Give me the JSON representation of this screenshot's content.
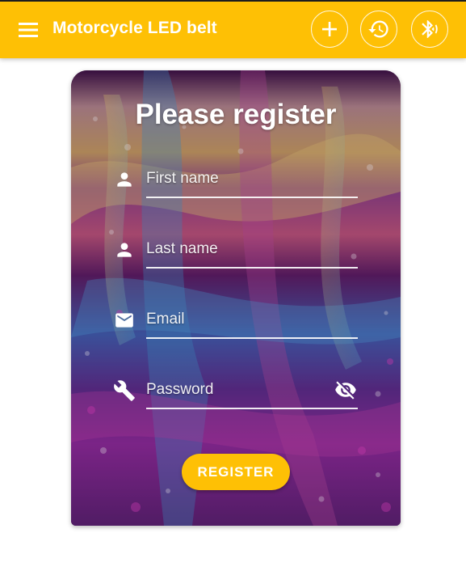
{
  "app_bar": {
    "title": "Motorcycle LED belt",
    "color": "#FEC005",
    "menu_icon": "menu-icon",
    "actions": [
      {
        "name": "add",
        "icon": "plus-icon"
      },
      {
        "name": "history",
        "icon": "history-icon"
      },
      {
        "name": "bluetooth",
        "icon": "bluetooth-icon"
      }
    ]
  },
  "form": {
    "heading": "Please register",
    "fields": [
      {
        "icon": "person-icon",
        "placeholder": "First name",
        "value": ""
      },
      {
        "icon": "person-icon",
        "placeholder": "Last name",
        "value": ""
      },
      {
        "icon": "email-icon",
        "placeholder": "Email",
        "value": ""
      },
      {
        "icon": "wrench-icon",
        "placeholder": "Password",
        "value": "",
        "toggle_icon": "visibility-off-icon"
      }
    ],
    "submit_label": "REGISTER",
    "submit_color": "#FEC005"
  }
}
